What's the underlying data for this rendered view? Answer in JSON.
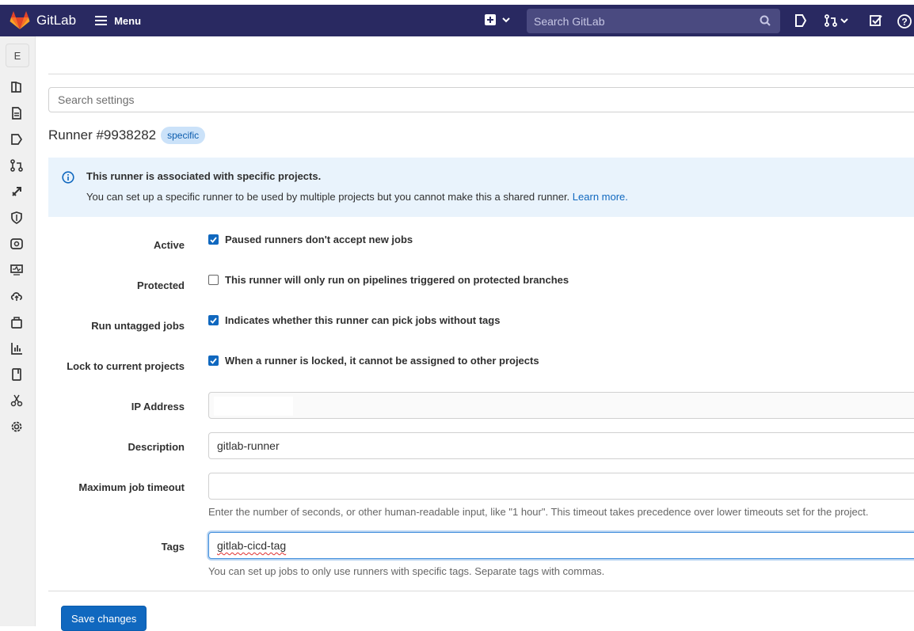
{
  "topbar": {
    "brand": "GitLab",
    "menu_label": "Menu",
    "search_placeholder": "Search GitLab",
    "color": "#292961"
  },
  "sidebar": {
    "project_initial": "E",
    "icons": [
      "project-overview-icon",
      "repository-icon",
      "issues-icon",
      "merge-requests-icon",
      "ci-cd-icon",
      "security-icon",
      "deployments-icon",
      "monitor-icon",
      "infrastructure-icon",
      "packages-icon",
      "analytics-icon",
      "wiki-icon",
      "snippets-icon",
      "settings-icon"
    ]
  },
  "settings_search": {
    "placeholder": "Search settings"
  },
  "runner": {
    "title": "Runner #9938282",
    "badge": "specific"
  },
  "alert": {
    "title": "This runner is associated with specific projects.",
    "body": "You can set up a specific runner to be used by multiple projects but you cannot make this a shared runner.",
    "link": "Learn more."
  },
  "form": {
    "active": {
      "label": "Active",
      "text": "Paused runners don't accept new jobs",
      "checked": true
    },
    "protected": {
      "label": "Protected",
      "text": "This runner will only run on pipelines triggered on protected branches",
      "checked": false
    },
    "untagged": {
      "label": "Run untagged jobs",
      "text": "Indicates whether this runner can pick jobs without tags",
      "checked": true
    },
    "locked": {
      "label": "Lock to current projects",
      "text": "When a runner is locked, it cannot be assigned to other projects",
      "checked": true
    },
    "ip": {
      "label": "IP Address",
      "value": ""
    },
    "description": {
      "label": "Description",
      "value": "gitlab-runner"
    },
    "timeout": {
      "label": "Maximum job timeout",
      "value": "",
      "help": "Enter the number of seconds, or other human-readable input, like \"1 hour\". This timeout takes precedence over lower timeouts set for the project."
    },
    "tags": {
      "label": "Tags",
      "value": "gitlab-cicd-tag",
      "help": "You can set up jobs to only use runners with specific tags. Separate tags with commas."
    },
    "save_label": "Save changes"
  }
}
